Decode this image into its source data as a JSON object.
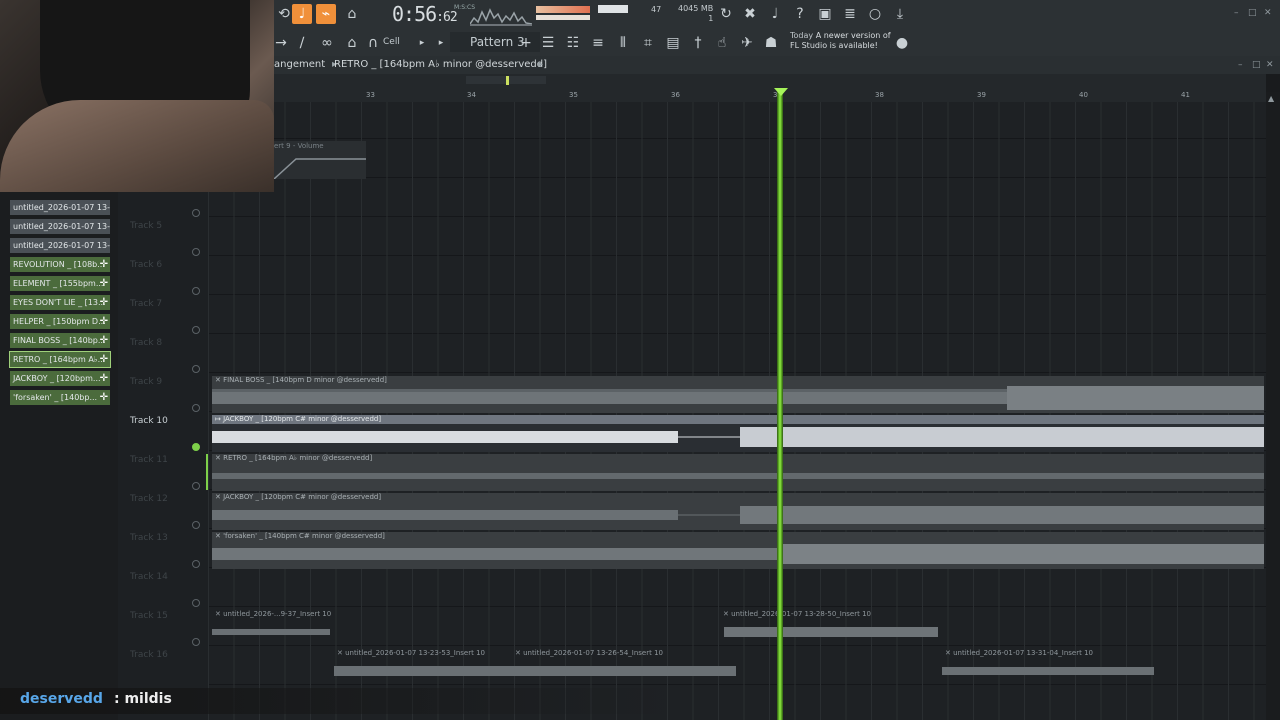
{
  "toolbar": {
    "time_main": "0:56",
    "time_frac": ":62",
    "time_unit": "M:S:CS",
    "cpu": "47",
    "memory": "4045 MB",
    "memory_sub": "1",
    "pattern": "Pattern 3",
    "snap": "Cell",
    "news_prefix": "Today",
    "news_text": "A newer version of",
    "news_text2": "FL Studio is available!"
  },
  "breadcrumb": {
    "section": "angement",
    "song": "RETRO _ [164bpm A♭ minor @desservedd]"
  },
  "ruler": {
    "bars": [
      "33",
      "34",
      "35",
      "36",
      "37",
      "38",
      "39",
      "40",
      "41"
    ]
  },
  "automation_clip": {
    "label": "ert 9 - Volume"
  },
  "browser": {
    "items": [
      {
        "label": "untitled_2026-01-07 13-...",
        "kind": "plain"
      },
      {
        "label": "untitled_2026-01-07 13-...",
        "kind": "plain"
      },
      {
        "label": "untitled_2026-01-07 13-...",
        "kind": "plain"
      },
      {
        "label": "REVOLUTION _ [108b...",
        "kind": "green"
      },
      {
        "label": "ELEMENT _ [155bpm...",
        "kind": "green"
      },
      {
        "label": "EYES DON'T LIE _ [13...",
        "kind": "green"
      },
      {
        "label": "HELPER _ [150bpm D...",
        "kind": "green"
      },
      {
        "label": "FINAL BOSS _ [140bp...",
        "kind": "green"
      },
      {
        "label": "RETRO _ [164bpm A♭...",
        "kind": "green",
        "selected": true
      },
      {
        "label": "JACKBOY _ [120bpm...",
        "kind": "green"
      },
      {
        "label": "'forsaken' _ [140bp...",
        "kind": "green"
      }
    ]
  },
  "tracks": [
    {
      "label": "Track 5"
    },
    {
      "label": "Track 6"
    },
    {
      "label": "Track 7"
    },
    {
      "label": "Track 8"
    },
    {
      "label": "Track 9"
    },
    {
      "label": "Track 10",
      "active": true
    },
    {
      "label": "Track 11"
    },
    {
      "label": "Track 12"
    },
    {
      "label": "Track 13"
    },
    {
      "label": "Track 14"
    },
    {
      "label": "Track 15"
    },
    {
      "label": "Track 16"
    }
  ],
  "clips": {
    "final_boss": "✕ FINAL BOSS _ [140bpm D minor @desservedd]",
    "jackboy_active": "↦ JACKBOY _ [120bpm C# minor @desservedd]",
    "retro": "✕ RETRO _ [164bpm A♭ minor @desservedd]",
    "jackboy": "✕ JACKBOY _ [120bpm C# minor @desservedd]",
    "forsaken": "✕ 'forsaken' _ [140bpm C# minor @desservedd]",
    "untitled_a": "✕ untitled_2026-...9-37_Insert 10",
    "untitled_b": "✕ untitled_2026-01-07 13-28-50_Insert 10",
    "untitled_c": "✕ untitled_2026-01-07 13-23-53_Insert 10",
    "untitled_d": "✕ untitled_2026-01-07 13-26-54_Insert 10",
    "untitled_e": "✕ untitled_2026-01-07 13-31-04_Insert 10"
  },
  "chat": {
    "user": "deservedd",
    "message": ": mildis"
  },
  "colors": {
    "accent": "#f0903a",
    "playhead": "#8ef040",
    "clip_green": "#4b6b3c"
  }
}
